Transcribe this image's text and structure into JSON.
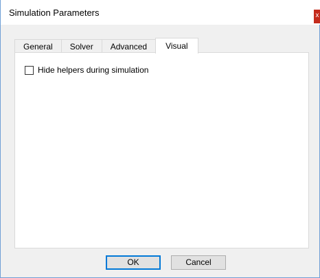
{
  "window": {
    "title": "Simulation Parameters",
    "close_glyph": "x"
  },
  "tabs": [
    {
      "label": "General",
      "active": false
    },
    {
      "label": "Solver",
      "active": false
    },
    {
      "label": "Advanced",
      "active": false
    },
    {
      "label": "Visual",
      "active": true
    }
  ],
  "visual_panel": {
    "hide_helpers": {
      "label": "Hide helpers during simulation",
      "checked": false
    }
  },
  "buttons": {
    "ok_label": "OK",
    "cancel_label": "Cancel"
  },
  "colors": {
    "close_button": "#c42b1c",
    "default_button_border": "#0078d7",
    "window_border": "#6f9fd6"
  }
}
